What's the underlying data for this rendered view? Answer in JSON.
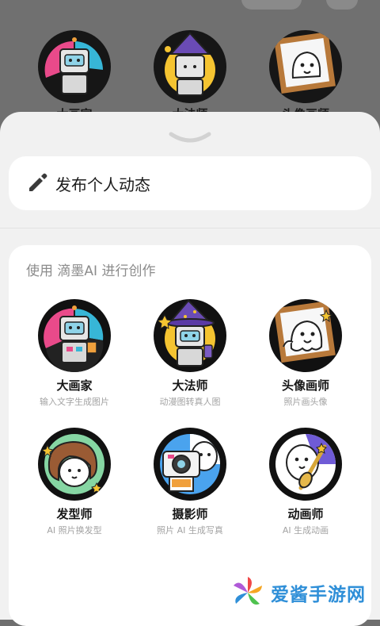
{
  "background": {
    "avatars": [
      {
        "icon": "robot-painter-icon",
        "label": "大画家"
      },
      {
        "icon": "robot-wizard-icon",
        "label": "大法师"
      },
      {
        "icon": "ghost-frame-icon",
        "label": "头像画师"
      }
    ]
  },
  "sheet": {
    "post": {
      "icon": "pencil-icon",
      "label": "发布个人动态"
    },
    "section_title": "使用 滴墨AI 进行创作",
    "tools": [
      {
        "icon": "robot-painter-icon",
        "name": "大画家",
        "desc": "输入文字生成图片"
      },
      {
        "icon": "robot-wizard-icon",
        "name": "大法师",
        "desc": "动漫图转真人图"
      },
      {
        "icon": "ghost-frame-icon",
        "name": "头像画师",
        "desc": "照片画头像"
      },
      {
        "icon": "hairstylist-icon",
        "name": "发型师",
        "desc": "AI 照片换发型"
      },
      {
        "icon": "camera-ghost-icon",
        "name": "摄影师",
        "desc": "照片 AI 生成写真"
      },
      {
        "icon": "ghost-guitar-icon",
        "name": "动画师",
        "desc": "AI 生成动画"
      }
    ]
  },
  "watermark": {
    "text": "爱酱手游网"
  },
  "colors": {
    "overlay": "#707070",
    "sheet": "#f1f1f1",
    "card": "#ffffff",
    "watermark": "#2f8fd8"
  }
}
